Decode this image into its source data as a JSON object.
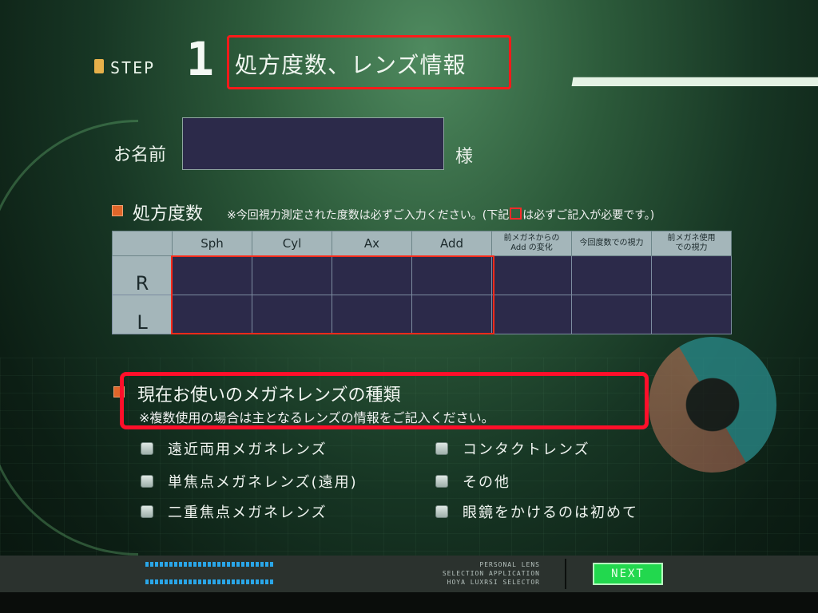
{
  "header": {
    "step_label": "STEP",
    "step_number": "1",
    "title": "処方度数、レンズ情報"
  },
  "name_field": {
    "label": "お名前",
    "value": "",
    "suffix": "様"
  },
  "prescription": {
    "title": "処方度数",
    "note_before": "※今回視力測定された度数は必ずご入力ください。(下記",
    "note_after": "は必ずご記入が必要です。)",
    "columns": [
      "Sph",
      "Cyl",
      "Ax",
      "Add",
      "前メガネからの",
      "Add の変化",
      "今回度数での視力",
      "前メガネ使用",
      "での視力"
    ],
    "rows": [
      "R",
      "L"
    ]
  },
  "lens_type": {
    "title": "現在お使いのメガネレンズの種類",
    "note": "※複数使用の場合は主となるレンズの情報をご記入ください。",
    "options": [
      "遠近両用メガネレンズ",
      "単焦点メガネレンズ(遠用)",
      "二重焦点メガネレンズ",
      "コンタクトレンズ",
      "その他",
      "眼鏡をかけるのは初めて"
    ]
  },
  "footer": {
    "brand_line1": "PERSONAL LENS",
    "brand_line2": "SELECTION APPLICATION",
    "brand_line3": "HOYA LUXRSI SELECTOR",
    "next_label": "NEXT"
  },
  "colors": {
    "accent_red": "#ff1a1a",
    "next_green": "#22d84e",
    "input_bg": "#2c2a4a"
  }
}
